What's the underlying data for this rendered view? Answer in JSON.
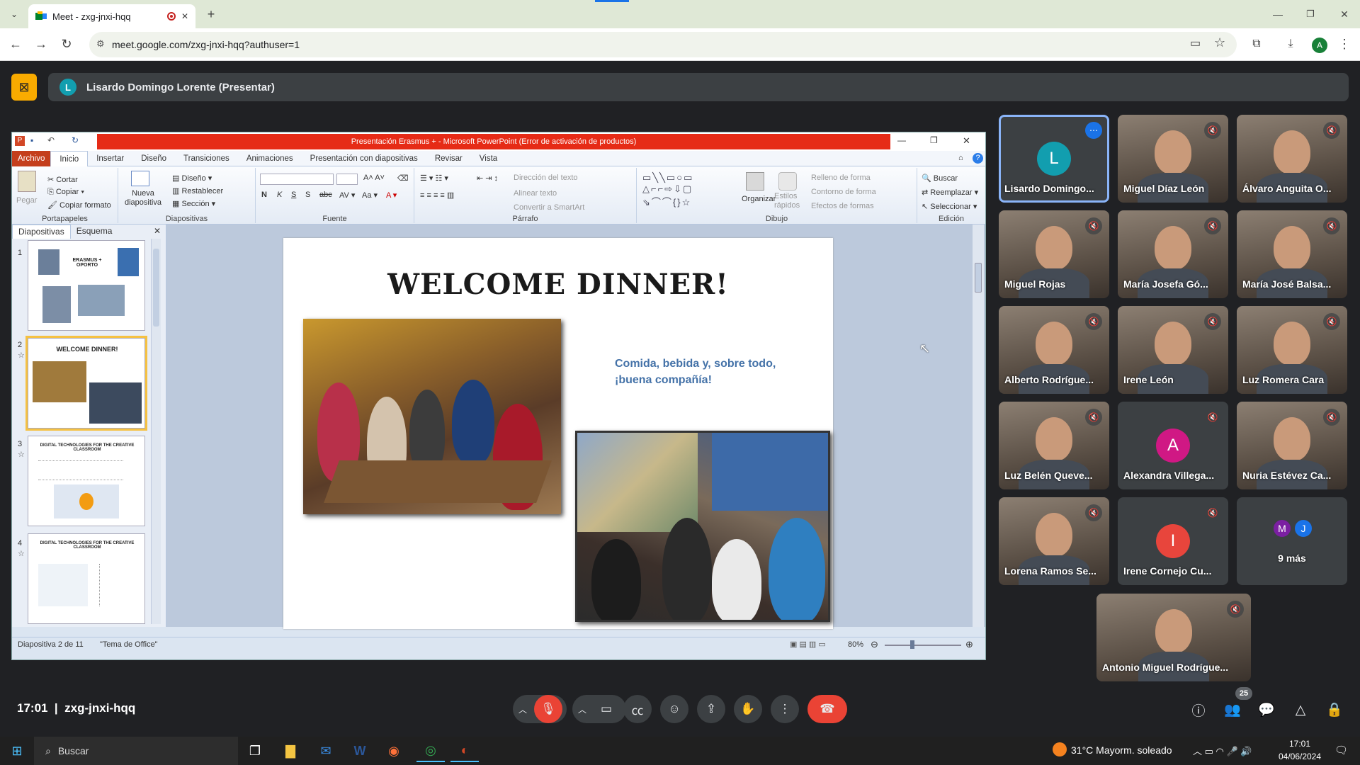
{
  "browser": {
    "tab_title": "Meet - zxg-jnxi-hqq",
    "url": "meet.google.com/zxg-jnxi-hqq?authuser=1",
    "profile_initial": "A",
    "new_tab_symbol": "+",
    "close_symbol": "✕"
  },
  "meet": {
    "presenter_initial": "L",
    "presenter_label": "Lisardo Domingo Lorente (Presentar)",
    "time": "17:01",
    "code": "zxg-jnxi-hqq",
    "people_count": "25",
    "colors": {
      "accent": "#8ab4f8",
      "end_call": "#ea4335",
      "stop_share": "#f9ab00"
    }
  },
  "ppt": {
    "window_title": "Presentación Erasmus + - Microsoft PowerPoint (Error de activación de productos)",
    "tabs": [
      "Archivo",
      "Inicio",
      "Insertar",
      "Diseño",
      "Transiciones",
      "Animaciones",
      "Presentación con diapositivas",
      "Revisar",
      "Vista"
    ],
    "ribbon": {
      "clipboard": {
        "paste": "Pegar",
        "cut": "Cortar",
        "copy": "Copiar",
        "format": "Copiar formato",
        "label": "Portapapeles"
      },
      "slides": {
        "new_slide": "Nueva diapositiva",
        "layout": "Diseño",
        "reset": "Restablecer",
        "section": "Sección",
        "label": "Diapositivas"
      },
      "font": {
        "label": "Fuente"
      },
      "paragraph": {
        "text_dir": "Dirección del texto",
        "align": "Alinear texto",
        "smartart": "Convertir a SmartArt",
        "label": "Párrafo"
      },
      "drawing": {
        "arrange": "Organizar",
        "quick_styles": "Estilos rápidos",
        "fill": "Relleno de forma",
        "outline": "Contorno de forma",
        "effects": "Efectos de formas",
        "label": "Dibujo"
      },
      "editing": {
        "find": "Buscar",
        "replace": "Reemplazar",
        "select": "Seleccionar",
        "label": "Edición"
      }
    },
    "panel_tabs": [
      "Diapositivas",
      "Esquema"
    ],
    "thumbs": [
      {
        "num": "1",
        "title": "ERASMUS + OPORTO"
      },
      {
        "num": "2",
        "title": "WELCOME DINNER!"
      },
      {
        "num": "3",
        "title": "DIGITAL TECHNOLOGIES FOR THE CREATIVE CLASSROOM"
      },
      {
        "num": "4",
        "title": "DIGITAL TECHNOLOGIES FOR THE CREATIVE CLASSROOM"
      }
    ],
    "slide": {
      "title": "WELCOME DINNER!",
      "text": "Comida, bebida y, sobre todo, ¡buena compañía!"
    },
    "status": {
      "slide_of": "Diapositiva 2 de 11",
      "theme": "\"Tema de Office\"",
      "zoom": "80%"
    }
  },
  "participants": [
    {
      "name": "Lisardo Domingo...",
      "initial": "L",
      "avatar_color": "#129eaf",
      "video": false,
      "speaking": true
    },
    {
      "name": "Miguel Díaz León",
      "video": true,
      "muted": true
    },
    {
      "name": "Álvaro Anguita O...",
      "video": true,
      "muted": true
    },
    {
      "name": "Miguel Rojas",
      "video": true,
      "muted": true
    },
    {
      "name": "María Josefa Gó...",
      "video": true,
      "muted": true
    },
    {
      "name": "María José Balsa...",
      "video": true,
      "muted": true
    },
    {
      "name": "Alberto Rodrígue...",
      "video": true,
      "muted": true
    },
    {
      "name": "Irene León",
      "video": true,
      "muted": true
    },
    {
      "name": "Luz Romera Cara",
      "video": true,
      "muted": true
    },
    {
      "name": "Luz Belén Queve...",
      "video": true,
      "muted": true
    },
    {
      "name": "Alexandra Villega...",
      "initial": "A",
      "avatar_color": "#d01884",
      "video": false,
      "muted": true
    },
    {
      "name": "Nuria Estévez Ca...",
      "video": true,
      "muted": true
    },
    {
      "name": "Lorena Ramos Se...",
      "video": true,
      "muted": true
    },
    {
      "name": "Irene Cornejo Cu...",
      "initial": "I",
      "avatar_color": "#e8453c",
      "video": false,
      "muted": true
    },
    {
      "name": "9 más",
      "more": true,
      "initials": [
        "M",
        "J"
      ]
    },
    {
      "name": "Antonio Miguel Rodrígue...",
      "video": true,
      "muted": true
    }
  ],
  "taskbar": {
    "search_placeholder": "Buscar",
    "weather": "31°C  Mayorm. soleado",
    "time": "17:01",
    "date": "04/06/2024"
  }
}
